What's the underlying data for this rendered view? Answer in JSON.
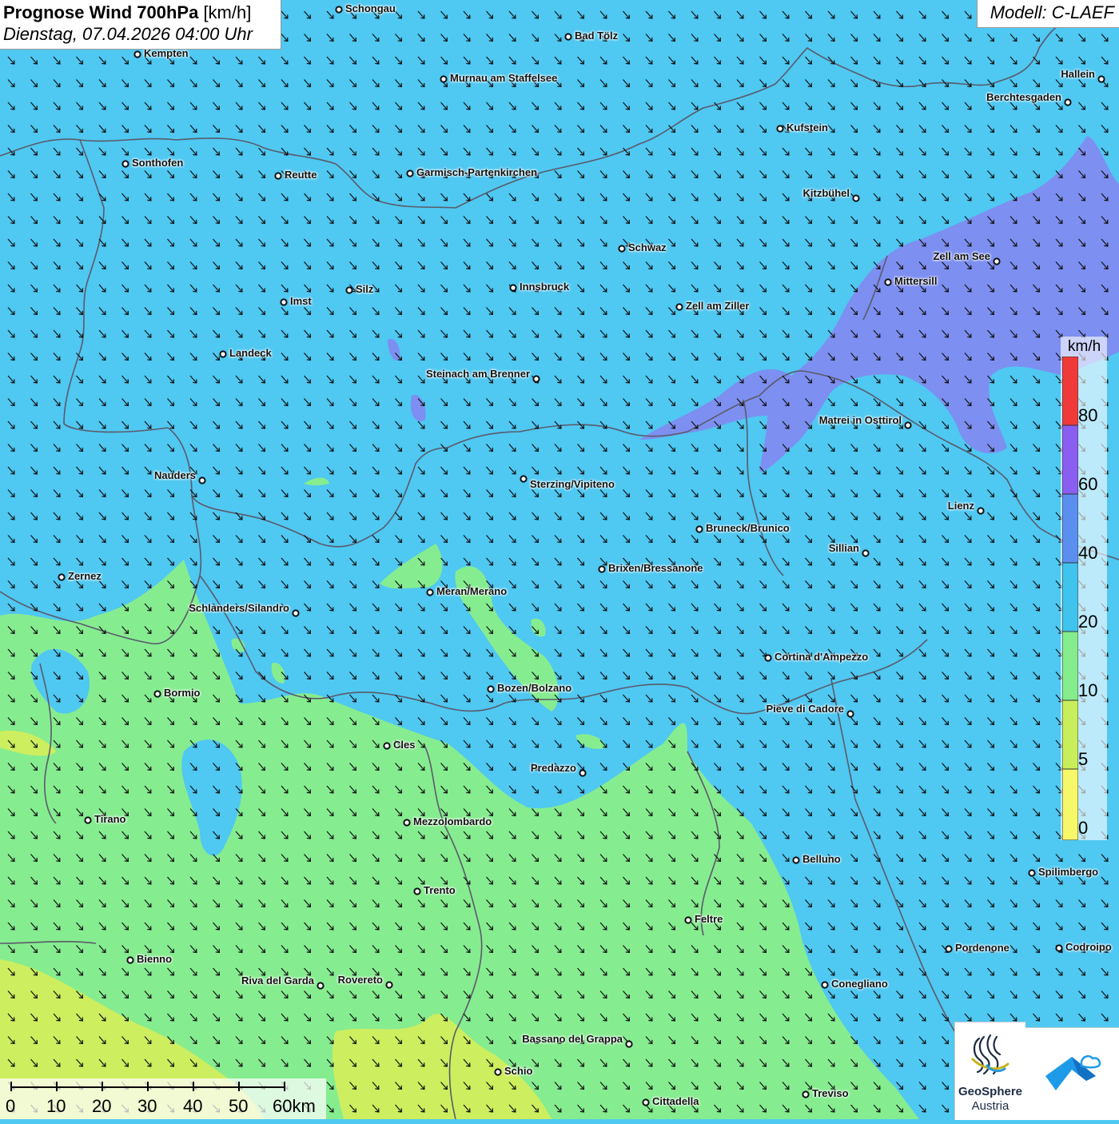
{
  "header": {
    "title_bold": "Prognose Wind 700hPa",
    "title_unit": "[km/h]",
    "datetime": "Dienstag, 07.04.2026 04:00 Uhr",
    "model": "Modell: C-LAEF"
  },
  "legend": {
    "unit": "km/h",
    "bands": [
      {
        "from": 0,
        "to": 5,
        "color": "#f7f76a"
      },
      {
        "from": 5,
        "to": 10,
        "color": "#c9ee5b"
      },
      {
        "from": 10,
        "to": 20,
        "color": "#84ec8c"
      },
      {
        "from": 20,
        "to": 40,
        "color": "#3fc4ee"
      },
      {
        "from": 40,
        "to": 60,
        "color": "#5a8ff0"
      },
      {
        "from": 60,
        "to": 80,
        "color": "#8a5ef0"
      },
      {
        "from": 80,
        "to": 100,
        "color": "#f03a3a"
      }
    ],
    "labels": [
      "80",
      "60",
      "40",
      "20",
      "10",
      "5",
      "0"
    ]
  },
  "scalebar": {
    "labels": [
      "0",
      "10",
      "20",
      "30",
      "40",
      "50",
      "60km"
    ]
  },
  "branding": {
    "org_line1": "GeoSphere",
    "org_line2": "Austria"
  },
  "wind": {
    "direction": "from north-west",
    "dominant_speed_band": "20-40 km/h"
  },
  "cities": [
    {
      "name": "Schongau"
    },
    {
      "name": "Bad Tölz"
    },
    {
      "name": "Kempten"
    },
    {
      "name": "Murnau am Staffelsee"
    },
    {
      "name": "Hallein"
    },
    {
      "name": "Berchtesgaden"
    },
    {
      "name": "Kufstein"
    },
    {
      "name": "Sonthofen"
    },
    {
      "name": "Reutte"
    },
    {
      "name": "Garmisch-Partenkirchen"
    },
    {
      "name": "Kitzbühel"
    },
    {
      "name": "Schwaz"
    },
    {
      "name": "Zell am See"
    },
    {
      "name": "Mittersill"
    },
    {
      "name": "Silz"
    },
    {
      "name": "Innsbruck"
    },
    {
      "name": "Imst"
    },
    {
      "name": "Zell am Ziller"
    },
    {
      "name": "Landeck"
    },
    {
      "name": "Steinach am Brenner"
    },
    {
      "name": "Matrei in Osttirol"
    },
    {
      "name": "Nauders"
    },
    {
      "name": "Sterzing/Vipiteno"
    },
    {
      "name": "Lienz"
    },
    {
      "name": "Bruneck/Brunico"
    },
    {
      "name": "Sillian"
    },
    {
      "name": "Zernez"
    },
    {
      "name": "Brixen/Bressanone"
    },
    {
      "name": "Meran/Merano"
    },
    {
      "name": "Schlanders/Silandro"
    },
    {
      "name": "Cortina d'Ampezzo"
    },
    {
      "name": "Bormio"
    },
    {
      "name": "Bozen/Bolzano"
    },
    {
      "name": "Pieve di Cadore"
    },
    {
      "name": "Cles"
    },
    {
      "name": "Predazzo"
    },
    {
      "name": "Tirano"
    },
    {
      "name": "Mezzolombardo"
    },
    {
      "name": "Belluno"
    },
    {
      "name": "Spilimbergo"
    },
    {
      "name": "Trento"
    },
    {
      "name": "Feltre"
    },
    {
      "name": "Pordenone"
    },
    {
      "name": "Codroipo"
    },
    {
      "name": "Bienno"
    },
    {
      "name": "Riva del Garda"
    },
    {
      "name": "Rovereto"
    },
    {
      "name": "Conegliano"
    },
    {
      "name": "Bassano del Grappa"
    },
    {
      "name": "Schio"
    },
    {
      "name": "Treviso"
    },
    {
      "name": "Cittadella"
    }
  ]
}
